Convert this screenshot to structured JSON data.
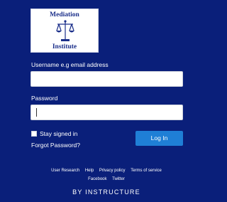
{
  "logo": {
    "line1": "Mediation",
    "line2": "Institute",
    "icon": "scales-of-justice-icon"
  },
  "form": {
    "username_label": "Username e.g email address",
    "username_value": "",
    "password_label": "Password",
    "password_value": "",
    "stay_signed_in_label": "Stay signed in",
    "stay_signed_in_checked": false,
    "forgot_password_label": "Forgot Password?",
    "login_button_label": "Log In"
  },
  "footer": {
    "links_row1": [
      "User Research",
      "Help",
      "Privacy policy",
      "Terms of service"
    ],
    "links_row2": [
      "Facebook",
      "Twitter"
    ],
    "brand": "BY INSTRUCTURE"
  },
  "colors": {
    "background": "#0a1f7a",
    "button": "#1f7fd6",
    "logo_text": "#1b2f8a"
  }
}
